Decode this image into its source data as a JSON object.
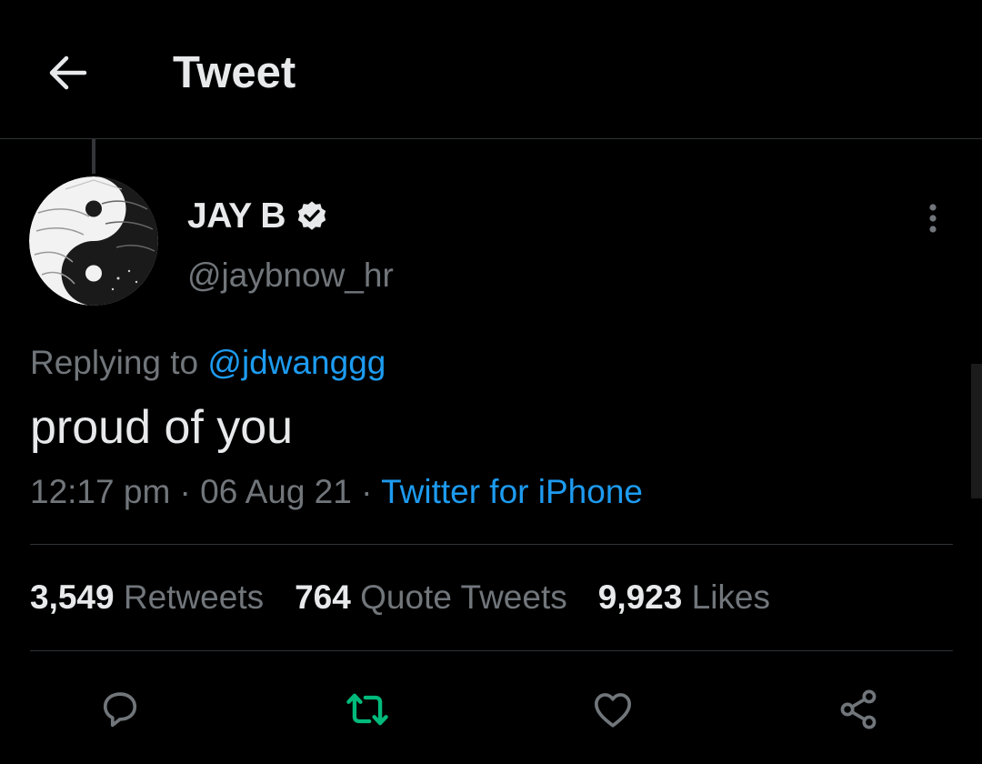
{
  "header": {
    "title": "Tweet"
  },
  "author": {
    "display_name": "JAY B",
    "handle": "@jaybnow_hr"
  },
  "tweet": {
    "replying_prefix": "Replying to ",
    "replying_to": "@jdwanggg",
    "text": "proud of you",
    "time": "12:17 pm",
    "separator": " · ",
    "date": "06 Aug 21",
    "source": "Twitter for iPhone"
  },
  "stats": {
    "retweets_count": "3,549",
    "retweets_label": "Retweets",
    "quotes_count": "764",
    "quotes_label": "Quote Tweets",
    "likes_count": "9,923",
    "likes_label": "Likes"
  },
  "icons": {
    "back": "arrow-left-icon",
    "verified": "verified-badge-icon",
    "more": "more-vertical-icon",
    "reply": "reply-icon",
    "retweet": "retweet-icon",
    "like": "heart-icon",
    "share": "share-icon"
  },
  "colors": {
    "background": "#000000",
    "text_primary": "#e7e9ea",
    "text_secondary": "#71767b",
    "link": "#1d9bf0",
    "retweet_active": "#00ba7c",
    "divider": "#2f3336"
  }
}
